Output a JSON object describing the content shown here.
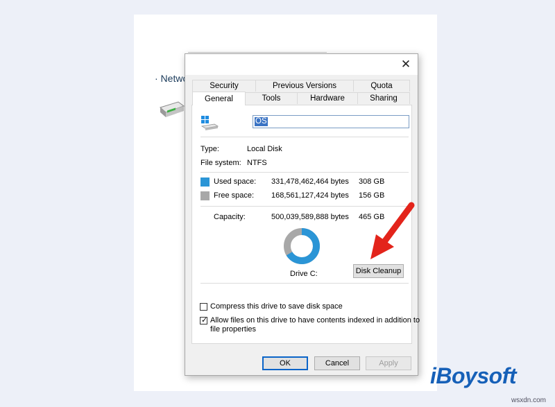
{
  "background": {
    "network_label": "· Netwo"
  },
  "dialog": {
    "close_glyph": "✕",
    "tabs_row1": [
      "Security",
      "Previous Versions",
      "Quota"
    ],
    "tabs_row2": [
      "General",
      "Tools",
      "Hardware",
      "Sharing"
    ],
    "active_tab": "General",
    "drive_name_value": "OS",
    "type_label": "Type:",
    "type_value": "Local Disk",
    "filesystem_label": "File system:",
    "filesystem_value": "NTFS",
    "used": {
      "label": "Used space:",
      "bytes": "331,478,462,464 bytes",
      "size": "308 GB",
      "color": "#2b95d6"
    },
    "free": {
      "label": "Free space:",
      "bytes": "168,561,127,424 bytes",
      "size": "156 GB",
      "color": "#a8a8a8"
    },
    "capacity": {
      "label": "Capacity:",
      "bytes": "500,039,589,888 bytes",
      "size": "465 GB"
    },
    "used_fraction": 0.663,
    "drive_label": "Drive C:",
    "disk_cleanup_label": "Disk Cleanup",
    "compress_label": "Compress this drive to save disk space",
    "compress_checked": false,
    "index_label_line1": "Allow files on this drive to have contents indexed in addition to",
    "index_label_line2": "file properties",
    "index_checked": true,
    "check_glyph": "✓",
    "ok_label": "OK",
    "cancel_label": "Cancel",
    "apply_label": "Apply"
  },
  "branding": {
    "logo_text": "iBoysoft",
    "logo_color": "#1660b8",
    "watermark": "wsxdn.com"
  },
  "colors": {
    "arrow": "#e3241b"
  }
}
